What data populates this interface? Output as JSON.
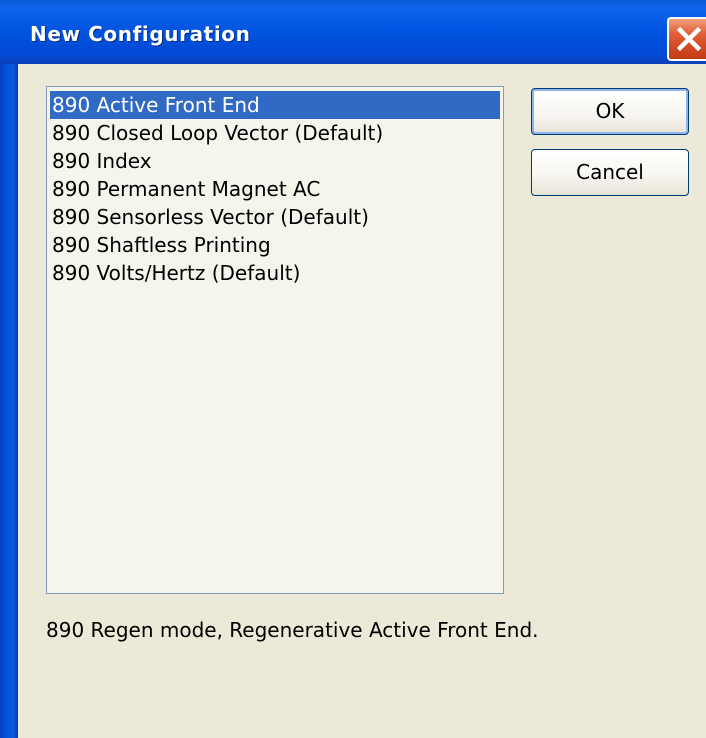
{
  "window": {
    "title": "New Configuration"
  },
  "list": {
    "selected_index": 0,
    "items": [
      "890 Active Front End",
      "890 Closed Loop Vector (Default)",
      "890 Index",
      "890 Permanent Magnet AC",
      "890 Sensorless Vector (Default)",
      "890 Shaftless Printing",
      "890 Volts/Hertz (Default)"
    ]
  },
  "buttons": {
    "ok_label": "OK",
    "cancel_label": "Cancel"
  },
  "description": "890 Regen mode, Regenerative Active Front End.",
  "icons": {
    "close": "close-icon"
  },
  "colors": {
    "titlebar": "#0053e0",
    "selection": "#316ac5",
    "dialog_background": "#ece9d8",
    "close_button": "#d04a22"
  }
}
